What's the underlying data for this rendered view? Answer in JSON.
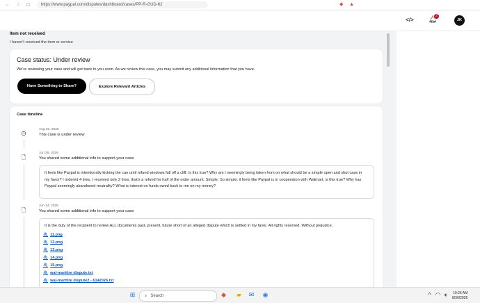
{
  "browser": {
    "url": "https://www.paypal.com/disputes/dashboard/cases/PP-R-GUD-62"
  },
  "header": {
    "notification_count": "2",
    "avatar_initials": "JK"
  },
  "reason": {
    "title": "Item not received",
    "subtitle": "I haven't received the item or service"
  },
  "status_card": {
    "title": "Case status: Under review",
    "description": "We're reviewing your case and will get back to you soon. As we review this case, you may submit any additional information that you have.",
    "primary_button": "Have Something to Share?",
    "secondary_button": "Explore Relevant Articles"
  },
  "timeline": {
    "title": "Case timeline",
    "events": [
      {
        "date": "Aug 20, 2026",
        "text": "This case is under review",
        "icon": "clock-icon"
      },
      {
        "date": "Jun 26, 2026",
        "text": "You shared some additional info to support your case",
        "icon": "document-icon",
        "message": "It feels like Paypal is intentionally kicking the can until refund windows fall off a cliff. Is this true? Why am I seemingly being taken from on what should be a simple open and shut case in my favor? I ordered 4 tires, I received only 2 tires, that's a refund for half of the order amount. Simple. So simple, it feels like Paypal is in cooperation with Walmart, is this true? Why has Paypal seemingly abandoned neutrality? What is interest on funds owed back to me on my money?"
      },
      {
        "date": "Jun 14, 2026",
        "text": "You shared some additional info to support your case",
        "icon": "document-icon",
        "message": "It is the duty of the recipient to review ALL documents past, present, future short of an alleged dispute which is settled in my favor. All rights reserved. Without prejudice.",
        "files": [
          "11.png",
          "12.png",
          "13.png",
          "14.png",
          "15.png",
          "wal-marttire dispute.txt",
          "wal-marttire dispute2 - 6142026.txt"
        ]
      }
    ]
  },
  "taskbar": {
    "search_placeholder": "Search",
    "time": "10:26 AM",
    "date": "8/30/2026"
  }
}
